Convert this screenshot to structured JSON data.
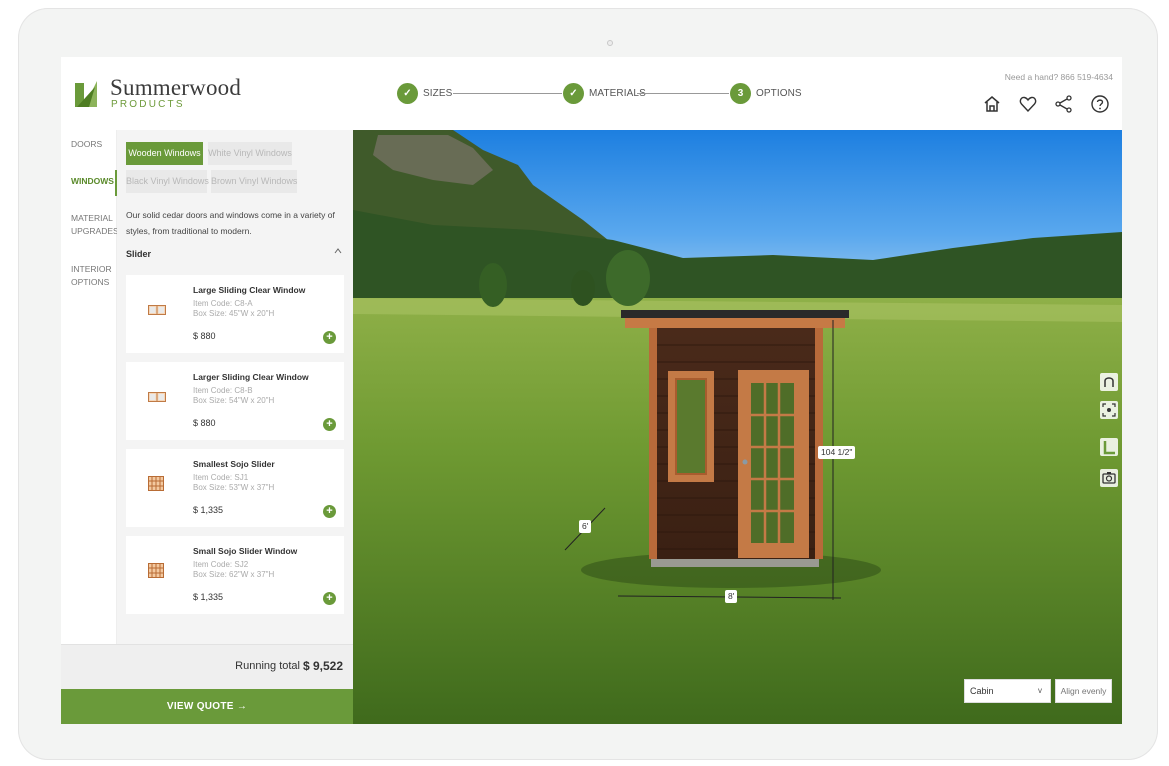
{
  "brand": {
    "name": "Summerwood",
    "sub": "PRODUCTS",
    "accent": "#6a9a3a"
  },
  "steps": [
    {
      "marker": "✓",
      "label": "SIZES"
    },
    {
      "marker": "✓",
      "label": "MATERIALS"
    },
    {
      "marker": "3",
      "label": "OPTIONS"
    }
  ],
  "help": "Need a hand? 866 519-4634",
  "header_icons": [
    "home-icon",
    "heart-icon",
    "share-icon",
    "help-icon"
  ],
  "nav": {
    "doors": "DOORS",
    "windows": "WINDOWS",
    "material_upgrades": [
      "MATERIAL",
      "UPGRADES"
    ],
    "interior_options": [
      "INTERIOR",
      "OPTIONS"
    ]
  },
  "tabs": {
    "wooden": "Wooden Windows",
    "white_vinyl": "White Vinyl Windows",
    "black_vinyl": "Black Vinyl Windows",
    "brown_vinyl": "Brown Vinyl Windows"
  },
  "description": "Our solid cedar doors and windows come in a variety of styles, from traditional to modern.",
  "section_title": "Slider",
  "products": [
    {
      "title": "Large Sliding Clear Window",
      "code": "Item Code: C8-A",
      "box": "Box Size: 45\"W x 20\"H",
      "price": "$ 880",
      "thumb": "slider"
    },
    {
      "title": "Larger Sliding Clear Window",
      "code": "Item Code: C8-B",
      "box": "Box Size: 54\"W x 20\"H",
      "price": "$ 880",
      "thumb": "slider"
    },
    {
      "title": "Smallest Sojo Slider",
      "code": "Item Code: SJ1",
      "box": "Box Size: 53\"W x 37\"H",
      "price": "$ 1,335",
      "thumb": "grid"
    },
    {
      "title": "Small Sojo Slider Window",
      "code": "Item Code: SJ2",
      "box": "Box Size: 62\"W x 37\"H",
      "price": "$ 1,335",
      "thumb": "grid"
    }
  ],
  "running_total": {
    "label": "Running total",
    "value": "$ 9,522"
  },
  "view_quote": "VIEW QUOTE →",
  "dimensions": {
    "height": "104 1/2\"",
    "depth": "6'",
    "width": "8'"
  },
  "viewport_tools": [
    "rotate-icon",
    "focus-icon",
    "measure-icon",
    "camera-icon"
  ],
  "building_select": "Cabin",
  "align_label": "Align evenly"
}
